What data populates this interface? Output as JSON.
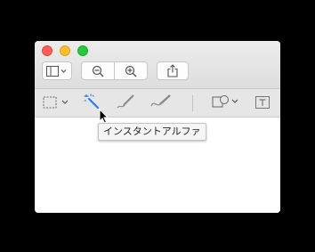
{
  "window": {
    "traffic_lights": [
      "close",
      "minimize",
      "zoom"
    ],
    "colors": {
      "close": "#ff5f57",
      "minimize": "#febc2e",
      "zoom": "#28c840"
    }
  },
  "toolbar": {
    "buttons": [
      {
        "name": "sidebar-view-button",
        "icon": "sidebar-icon",
        "has_dropdown": true
      },
      {
        "name": "zoom-out-button",
        "icon": "zoom-out-icon"
      },
      {
        "name": "zoom-in-button",
        "icon": "zoom-in-icon"
      },
      {
        "name": "share-button",
        "icon": "share-icon"
      }
    ]
  },
  "markup_toolbar": {
    "tools": [
      {
        "name": "selection-tool",
        "icon": "rectangular-selection-icon",
        "has_dropdown": true
      },
      {
        "name": "instant-alpha-tool",
        "icon": "magic-wand-icon",
        "active": true
      },
      {
        "name": "sketch-tool",
        "icon": "sketch-pen-icon"
      },
      {
        "name": "draw-tool",
        "icon": "draw-pen-icon"
      },
      {
        "name": "shapes-tool",
        "icon": "shapes-icon",
        "has_dropdown": true
      },
      {
        "name": "text-tool",
        "icon": "text-box-icon"
      }
    ],
    "accent_color": "#2a7ef0"
  },
  "tooltip": {
    "text": "インスタントアルファ"
  }
}
